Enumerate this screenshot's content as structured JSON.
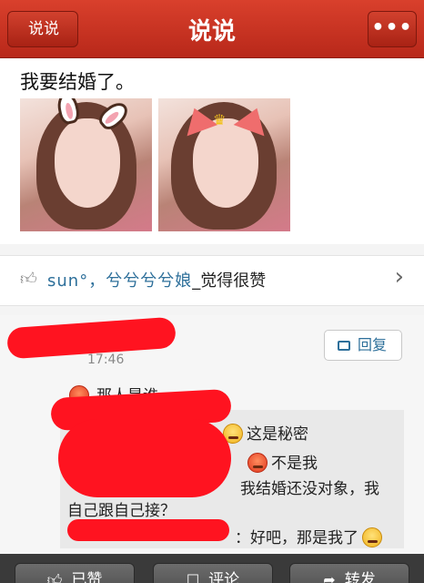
{
  "header": {
    "back_label": "说说",
    "title": "说说",
    "more_label": "•••"
  },
  "post": {
    "text": "我要结婚了。",
    "photos": [
      "photo-with-bunny-ears",
      "photo-with-cat-ears"
    ]
  },
  "likes": {
    "names": "sun°，兮兮兮兮娘",
    "suffix": "_觉得很赞"
  },
  "comment": {
    "time": "17:46",
    "reply_label": "回复",
    "text": "那人是谁…"
  },
  "replies": [
    {
      "text": "这是秘密"
    },
    {
      "text": "不是我"
    },
    {
      "text": "我结婚还没对象，我"
    },
    {
      "text": "自己跟自己接？"
    },
    {
      "text": "好吧，那是我了"
    }
  ],
  "reply_prefix": "：",
  "bottom_bar": {
    "like_label": "已赞",
    "comment_label": "评论",
    "share_label": "转发"
  },
  "colors": {
    "header_red": "#c8321f",
    "link_blue": "#2d6f9a",
    "redaction_red": "#ff1320"
  }
}
